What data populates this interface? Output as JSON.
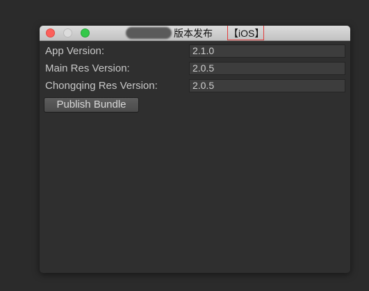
{
  "window": {
    "title_main": "版本发布",
    "title_platform": "【iOS】"
  },
  "fields": [
    {
      "label": "App Version:",
      "value": "2.1.0"
    },
    {
      "label": "Main Res Version:",
      "value": "2.0.5"
    },
    {
      "label": "Chongqing Res Version:",
      "value": "2.0.5"
    }
  ],
  "actions": {
    "publish_label": "Publish Bundle"
  },
  "colors": {
    "background": "#2b2b2b",
    "panel": "#2f2f2f",
    "highlight": "#e23b3b",
    "close": "#fc605b",
    "minimize": "#dcdcdc",
    "maximize": "#34c84a"
  }
}
